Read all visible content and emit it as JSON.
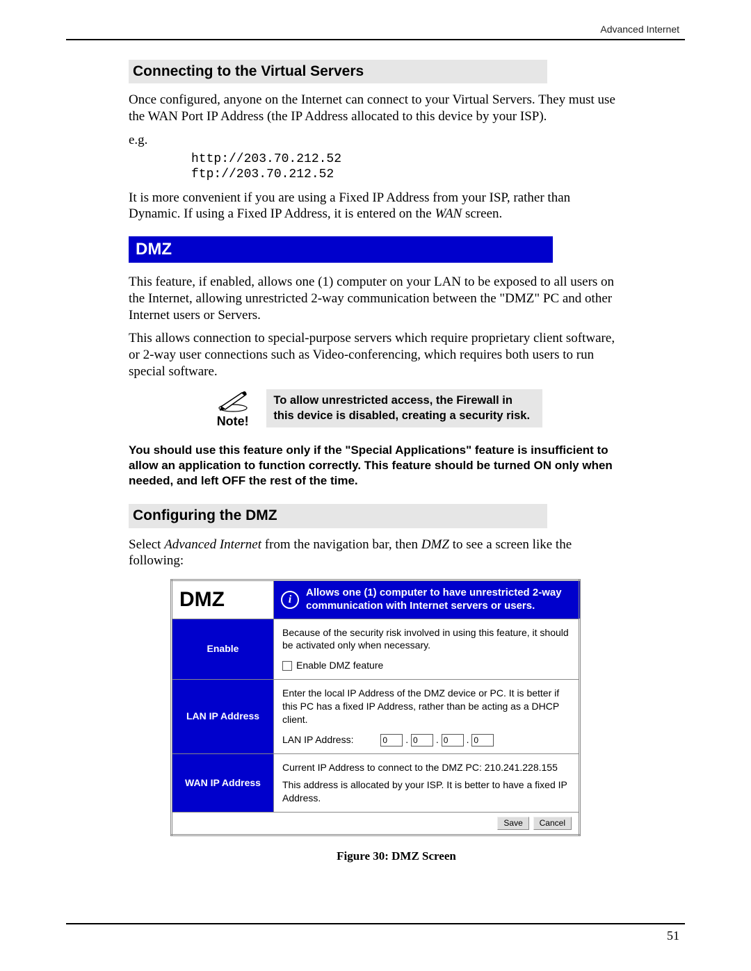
{
  "header": {
    "title": "Advanced Internet"
  },
  "section1": {
    "heading": "Connecting to the Virtual Servers",
    "para1": "Once configured, anyone on the Internet can connect to your Virtual Servers. They must use the WAN Port IP Address (the IP Address allocated to this device by your ISP).",
    "eg_label": "e.g.",
    "code": "http://203.70.212.52\nftp://203.70.212.52",
    "para2_a": "It is more convenient if you are using a Fixed IP Address from your ISP, rather than Dynamic. If using a Fixed IP Address, it is entered on the ",
    "para2_em": "WAN",
    "para2_b": " screen."
  },
  "dmz_bar": "DMZ",
  "dmz_intro": {
    "p1": "This feature, if enabled, allows one (1) computer on your LAN to be exposed to all users on the Internet, allowing unrestricted 2-way communication between the \"DMZ\" PC and other Internet users or Servers.",
    "p2": "This allows connection to special-purpose servers which require proprietary client software, or 2-way user connections such as Video-conferencing, which requires both users to run special software."
  },
  "note": {
    "label": "Note!",
    "text": "To allow unrestricted access, the Firewall in this device is disabled, creating a security risk."
  },
  "warning": "You should use this feature only if the \"Special Applications\" feature is insufficient to allow an application to function correctly. This feature should be turned ON only when needed, and left OFF the rest of the time.",
  "section2": {
    "heading": "Configuring the DMZ",
    "instruction_a": "Select ",
    "instruction_em1": "Advanced Internet",
    "instruction_b": " from the navigation bar, then ",
    "instruction_em2": "DMZ",
    "instruction_c": " to see a screen like the following:"
  },
  "form": {
    "title": "DMZ",
    "description": "Allows one (1) computer to have unrestricted 2-way communication with Internet servers or users.",
    "enable": {
      "label": "Enable",
      "text": "Because of the security risk involved in using this feature, it should be activated only when necessary.",
      "checkbox_label": "Enable DMZ feature"
    },
    "lan": {
      "label": "LAN IP Address",
      "text": "Enter the local IP Address of the DMZ device or PC. It is better if this PC has a fixed IP Address, rather than be acting as a DHCP client.",
      "field_label": "LAN IP Address:",
      "ip": [
        "0",
        "0",
        "0",
        "0"
      ]
    },
    "wan": {
      "label": "WAN IP Address",
      "text1": "Current IP Address to connect to the DMZ PC:  210.241.228.155",
      "text2": "This address is allocated by your ISP. It is better to have a fixed IP Address."
    },
    "buttons": {
      "save": "Save",
      "cancel": "Cancel"
    }
  },
  "caption": "Figure 30: DMZ Screen",
  "page_number": "51"
}
